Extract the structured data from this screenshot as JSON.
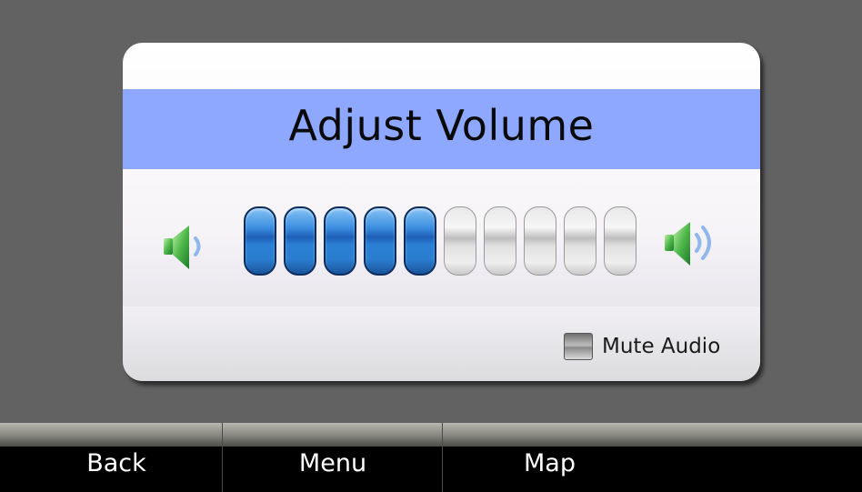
{
  "dialog": {
    "title": "Adjust Volume",
    "volume": {
      "level": 5,
      "max": 10,
      "low_icon": "speaker-low-icon",
      "high_icon": "speaker-high-icon"
    },
    "mute": {
      "label": "Mute Audio",
      "checked": false
    }
  },
  "nav": {
    "back_label": "Back",
    "menu_label": "Menu",
    "map_label": "Map"
  },
  "colors": {
    "background": "#626262",
    "title_band": "#8fa8ff",
    "segment_on": "#2a7dcf",
    "segment_off": "#e2e2e2",
    "speaker_green": "#3fa14a"
  }
}
